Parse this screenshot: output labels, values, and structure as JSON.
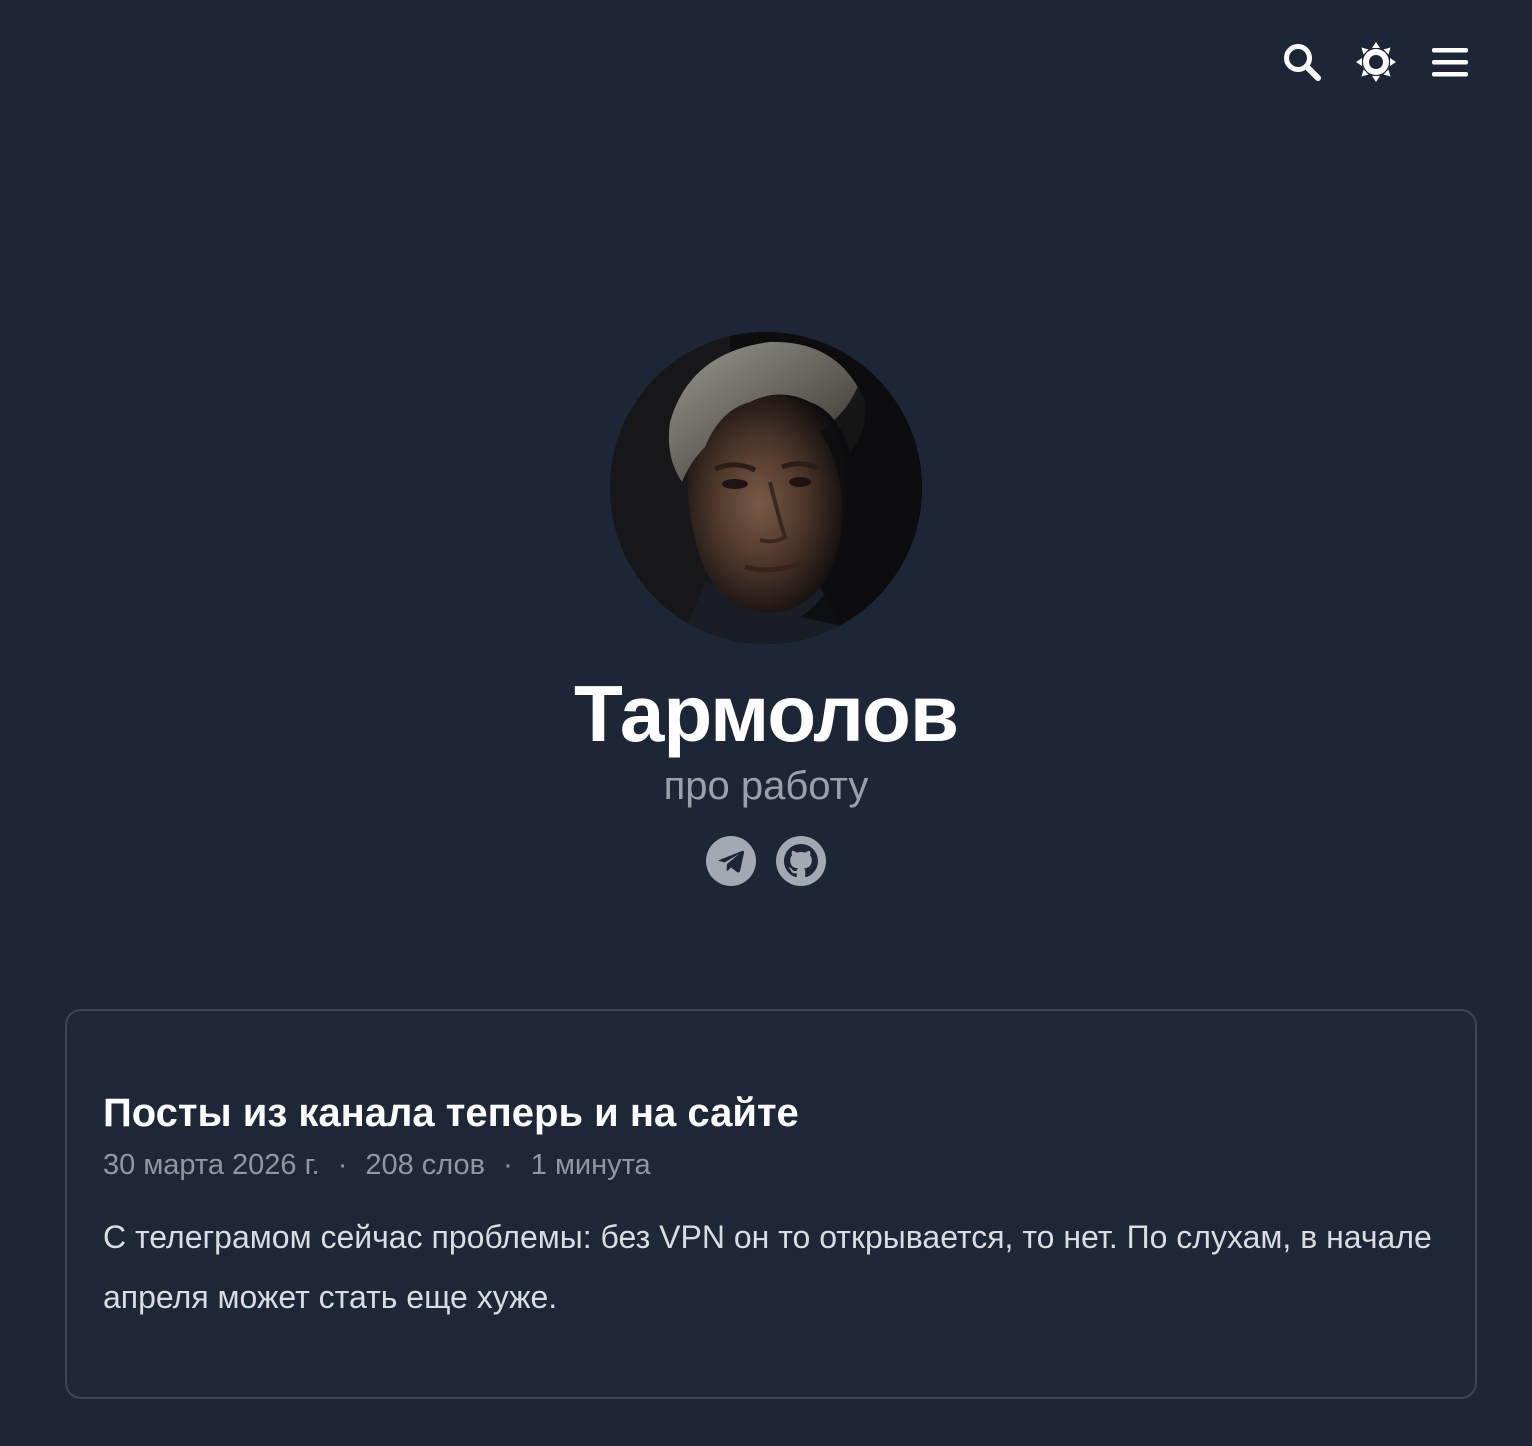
{
  "header": {
    "icons": [
      "search-icon",
      "theme-toggle-icon",
      "menu-icon"
    ]
  },
  "profile": {
    "title": "Тармолов",
    "subtitle": "про работу",
    "social": [
      "telegram-icon",
      "github-icon"
    ]
  },
  "post": {
    "title": "Посты из канала теперь и на сайте",
    "date": "30 марта 2026 г.",
    "separator": "·",
    "words": "208 слов",
    "reading_time": "1 минута",
    "summary": "С телеграмом сейчас проблемы: без VPN он то открывается, то нет. По слухам, в начале апреля может стать еще хуже."
  },
  "colors": {
    "background": "#1d2636",
    "text_primary": "#ffffff",
    "text_muted": "#9aa1ad",
    "card_border": "#3d4556"
  }
}
